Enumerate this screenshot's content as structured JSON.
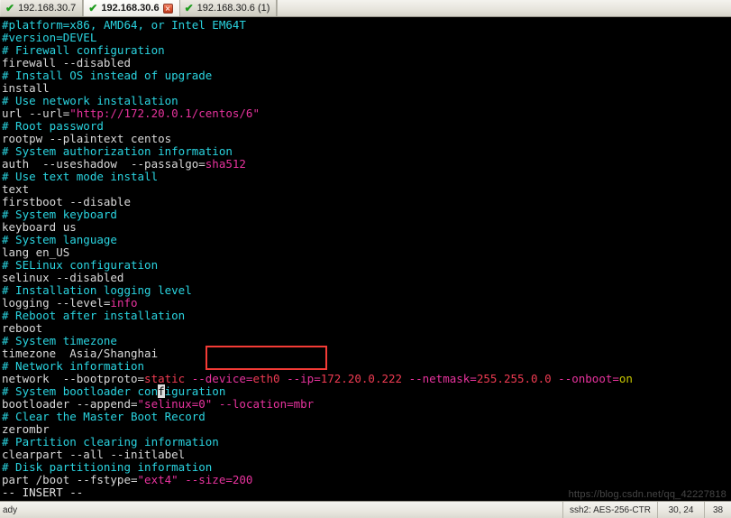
{
  "tabs": [
    {
      "label": "192.168.30.7",
      "icon": "check-icon",
      "active": false,
      "closable": false
    },
    {
      "label": "192.168.30.6",
      "icon": "check-icon",
      "active": true,
      "closable": true,
      "close_glyph": "×"
    },
    {
      "label": "192.168.30.6 (1)",
      "icon": "check-icon",
      "active": false,
      "closable": false
    }
  ],
  "terminal": {
    "lines": [
      {
        "segments": [
          {
            "t": "#platform=x86, AMD64, or Intel EM64T",
            "c": "comment"
          }
        ]
      },
      {
        "segments": [
          {
            "t": "#version=DEVEL",
            "c": "comment"
          }
        ]
      },
      {
        "segments": [
          {
            "t": "# Firewall configuration",
            "c": "comment"
          }
        ]
      },
      {
        "segments": [
          {
            "t": "firewall --disabled",
            "c": "plain"
          }
        ]
      },
      {
        "segments": [
          {
            "t": "# Install OS instead of upgrade",
            "c": "comment"
          }
        ]
      },
      {
        "segments": [
          {
            "t": "install",
            "c": "plain"
          }
        ]
      },
      {
        "segments": [
          {
            "t": "# Use network installation",
            "c": "comment"
          }
        ]
      },
      {
        "segments": [
          {
            "t": "url --url=",
            "c": "plain"
          },
          {
            "t": "\"http://172.20.0.1/centos/6\"",
            "c": "string"
          }
        ]
      },
      {
        "segments": [
          {
            "t": "# Root password",
            "c": "comment"
          }
        ]
      },
      {
        "segments": [
          {
            "t": "rootpw --plaintext centos",
            "c": "plain"
          }
        ]
      },
      {
        "segments": [
          {
            "t": "# System authorization information",
            "c": "comment"
          }
        ]
      },
      {
        "segments": [
          {
            "t": "auth  --useshadow  --passalgo=",
            "c": "plain"
          },
          {
            "t": "sha512",
            "c": "string"
          }
        ]
      },
      {
        "segments": [
          {
            "t": "# Use text mode install",
            "c": "comment"
          }
        ]
      },
      {
        "segments": [
          {
            "t": "text",
            "c": "plain"
          }
        ]
      },
      {
        "segments": [
          {
            "t": "firstboot --disable",
            "c": "plain"
          }
        ]
      },
      {
        "segments": [
          {
            "t": "# System keyboard",
            "c": "comment"
          }
        ]
      },
      {
        "segments": [
          {
            "t": "keyboard us",
            "c": "plain"
          }
        ]
      },
      {
        "segments": [
          {
            "t": "# System language",
            "c": "comment"
          }
        ]
      },
      {
        "segments": [
          {
            "t": "lang en_US",
            "c": "plain"
          }
        ]
      },
      {
        "segments": [
          {
            "t": "# SELinux configuration",
            "c": "comment"
          }
        ]
      },
      {
        "segments": [
          {
            "t": "selinux --disabled",
            "c": "plain"
          }
        ]
      },
      {
        "segments": [
          {
            "t": "# Installation logging level",
            "c": "comment"
          }
        ]
      },
      {
        "segments": [
          {
            "t": "logging --level=",
            "c": "plain"
          },
          {
            "t": "info",
            "c": "string"
          }
        ]
      },
      {
        "segments": [
          {
            "t": "# Reboot after installation",
            "c": "comment"
          }
        ]
      },
      {
        "segments": [
          {
            "t": "reboot",
            "c": "plain"
          }
        ]
      },
      {
        "segments": [
          {
            "t": "# System timezone",
            "c": "comment"
          }
        ]
      },
      {
        "segments": [
          {
            "t": "timezone  Asia/Shanghai",
            "c": "plain"
          }
        ]
      },
      {
        "segments": [
          {
            "t": "# Network information",
            "c": "comment"
          }
        ]
      },
      {
        "segments": [
          {
            "t": "network  --bootproto=",
            "c": "plain"
          },
          {
            "t": "static",
            "c": "value"
          },
          {
            "t": " --device=",
            "c": "option"
          },
          {
            "t": "eth0",
            "c": "value"
          },
          {
            "t": " --ip=",
            "c": "option"
          },
          {
            "t": "172.20.0.222",
            "c": "value"
          },
          {
            "t": " --netmask=",
            "c": "option"
          },
          {
            "t": "255.255.0.0",
            "c": "value"
          },
          {
            "t": " --onboot=",
            "c": "option"
          },
          {
            "t": "on",
            "c": "special"
          }
        ]
      },
      {
        "segments": [
          {
            "t": "# System bootloader con",
            "c": "comment"
          },
          {
            "t": "f",
            "c": "cursor"
          },
          {
            "t": "iguration",
            "c": "comment"
          }
        ]
      },
      {
        "segments": [
          {
            "t": "bootloader --append=",
            "c": "plain"
          },
          {
            "t": "\"selinux=0\"",
            "c": "string"
          },
          {
            "t": " --location=mbr",
            "c": "option"
          }
        ]
      },
      {
        "segments": [
          {
            "t": "# Clear the Master Boot Record",
            "c": "comment"
          }
        ]
      },
      {
        "segments": [
          {
            "t": "zerombr",
            "c": "plain"
          }
        ]
      },
      {
        "segments": [
          {
            "t": "# Partition clearing information",
            "c": "comment"
          }
        ]
      },
      {
        "segments": [
          {
            "t": "clearpart --all --initlabel",
            "c": "plain"
          }
        ]
      },
      {
        "segments": [
          {
            "t": "# Disk partitioning information",
            "c": "comment"
          }
        ]
      },
      {
        "segments": [
          {
            "t": "part /boot --fstype=",
            "c": "plain"
          },
          {
            "t": "\"ext4\"",
            "c": "string"
          },
          {
            "t": " --size=200",
            "c": "option"
          }
        ]
      },
      {
        "segments": [
          {
            "t": "-- INSERT --",
            "c": "status"
          }
        ]
      }
    ],
    "watermark": "https://blog.csdn.net/qq_42227818"
  },
  "statusbar": {
    "ready": "ady",
    "cipher": "ssh2: AES-256-CTR",
    "position": "30, 24",
    "extra": "38"
  },
  "colors": {
    "comment": "#2ad4e0",
    "plain": "#d9d9d9",
    "string": "#e8339e",
    "value": "#ef3b52",
    "special": "#c8c800",
    "annotation": "#f43b36",
    "terminal_bg": "#000000"
  }
}
